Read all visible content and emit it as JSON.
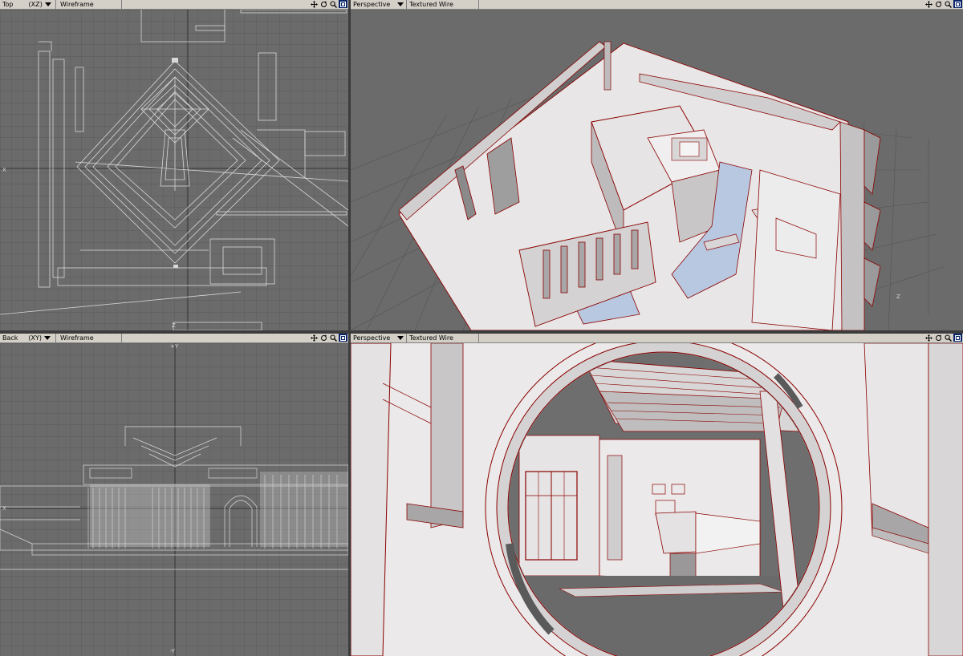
{
  "viewports": {
    "top_left": {
      "view": "Top",
      "axes": "(XZ)",
      "mode": "Wireframe",
      "axis_labels": {
        "left": "X",
        "bottom": "Z"
      }
    },
    "top_right": {
      "view": "Perspective",
      "mode": "Textured Wire",
      "axis_labels": {
        "right": "Z"
      }
    },
    "bottom_left": {
      "view": "Back",
      "axes": "(XY)",
      "mode": "Wireframe",
      "axis_labels": {
        "top": "+Y",
        "bottom": "-Y",
        "left": "X"
      }
    },
    "bottom_right": {
      "view": "Perspective",
      "mode": "Textured Wire"
    }
  },
  "icons": [
    "move-icon",
    "rotate-icon",
    "zoom-icon",
    "maximize-icon"
  ],
  "colors": {
    "toolbar": "#d4d0c8",
    "viewport_bg": "#6b6b6b",
    "wire": "#d8d8d8",
    "edge": "#8b0000",
    "surface": "#e8e6e6",
    "water": "#b8c8e0"
  }
}
